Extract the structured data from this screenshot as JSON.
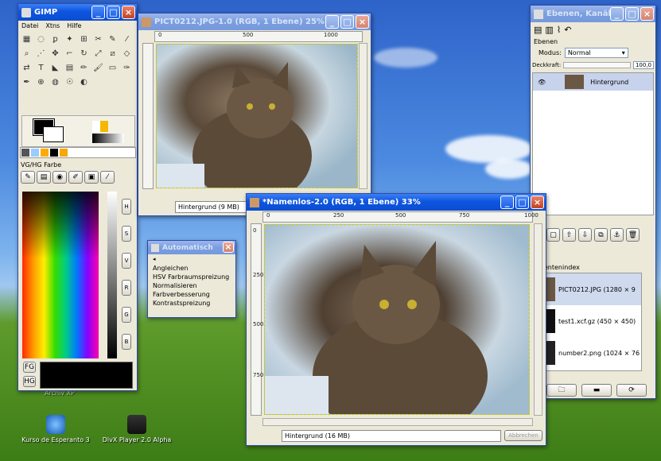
{
  "gimp": {
    "title": "GIMP",
    "menu": [
      "Datei",
      "Xtns",
      "Hilfe"
    ],
    "fg_bg_label": "VG/HG Farbe",
    "fg": "FG",
    "hg": "HG",
    "channels": [
      "H",
      "S",
      "V",
      "R",
      "G",
      "B"
    ],
    "fg_color": "#000000",
    "bg_color": "#ffffff",
    "tool_icons": [
      "rect-select",
      "ellipse-select",
      "free-select",
      "fuzzy-select",
      "color-select",
      "scissors",
      "paths",
      "color-picker",
      "zoom",
      "measure",
      "move",
      "crop",
      "rotate",
      "scale",
      "shear",
      "perspective",
      "flip",
      "text",
      "bucket-fill",
      "blend",
      "pencil",
      "paintbrush",
      "eraser",
      "airbrush",
      "ink",
      "clone",
      "convolve",
      "smudge",
      "dodge-burn"
    ]
  },
  "img1": {
    "title": "PICT0212.JPG-1.0 (RGB, 1 Ebene) 25%",
    "ruler": [
      "0",
      "500",
      "1000"
    ],
    "status": "Hintergrund (9 MB)"
  },
  "img2": {
    "title": "*Namenlos-2.0 (RGB, 1 Ebene) 33%",
    "ruler": [
      "0",
      "250",
      "500",
      "750",
      "1000"
    ],
    "vruler": [
      "0",
      "250",
      "500",
      "750"
    ],
    "status": "Hintergrund (16 MB)",
    "cancel": "Abbrechen"
  },
  "layers": {
    "title": "Ebenen, Kanäl...",
    "section": "Ebenen",
    "mode_label": "Modus:",
    "mode_value": "Normal",
    "opacity_label": "Deckkraft:",
    "opacity_value": "100,0",
    "layer_name": "Hintergrund",
    "docs_label": "umentenindex",
    "docs": [
      "PICT0212.JPG (1280 × 9",
      "test1.xcf.gz (450 × 450)",
      "number2.png (1024 × 76"
    ]
  },
  "auto": {
    "title": "Automatisch",
    "items": [
      "Angleichen",
      "HSV Farbraumspreizung",
      "Normalisieren",
      "Farbverbesserung",
      "Kontrastspreizung"
    ]
  },
  "desktop": {
    "icons": [
      "Kurso de Esperanto 3",
      "DivX Player 2.0 Alpha"
    ],
    "partial": "Archiv XP"
  }
}
